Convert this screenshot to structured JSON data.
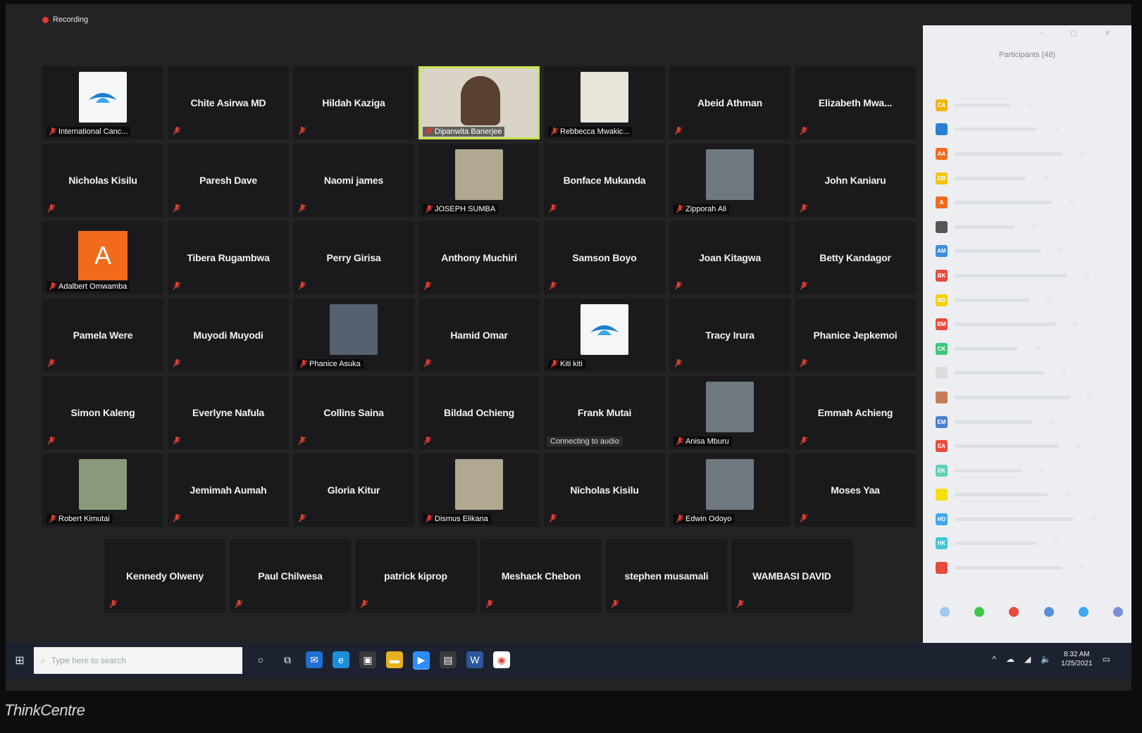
{
  "recording": {
    "label": "Recording"
  },
  "tiles": [
    {
      "name": "International Canc...",
      "type": "logo"
    },
    {
      "name": "Chite Asirwa MD",
      "type": "name"
    },
    {
      "name": "Hildah Kaziga",
      "type": "name"
    },
    {
      "name": "Dipanwita Banerjee",
      "type": "video",
      "active": true
    },
    {
      "name": "Rebbecca Mwakic...",
      "type": "photo"
    },
    {
      "name": "Abeid Athman",
      "type": "name"
    },
    {
      "name": "Elizabeth Mwa...",
      "type": "name"
    },
    {
      "name": "Nicholas Kisilu",
      "type": "name"
    },
    {
      "name": "Paresh Dave",
      "type": "name"
    },
    {
      "name": "Naomi james",
      "type": "name"
    },
    {
      "name": "JOSEPH SUMBA",
      "type": "photo"
    },
    {
      "name": "Bonface Mukanda",
      "type": "name"
    },
    {
      "name": "Zipporah Ali",
      "type": "photo"
    },
    {
      "name": "John Kaniaru",
      "type": "name"
    },
    {
      "name": "Adalbert Omwamba",
      "type": "letter",
      "letter": "A"
    },
    {
      "name": "Tibera Rugambwa",
      "type": "name"
    },
    {
      "name": "Perry Girisa",
      "type": "name"
    },
    {
      "name": "Anthony Muchiri",
      "type": "name"
    },
    {
      "name": "Samson Boyo",
      "type": "name"
    },
    {
      "name": "Joan Kitagwa",
      "type": "name"
    },
    {
      "name": "Betty Kandagor",
      "type": "name"
    },
    {
      "name": "Pamela Were",
      "type": "name"
    },
    {
      "name": "Muyodi Muyodi",
      "type": "name"
    },
    {
      "name": "Phanice Asuka",
      "type": "photo"
    },
    {
      "name": "Hamid Omar",
      "type": "name"
    },
    {
      "name": "Kiti kiti",
      "type": "logo"
    },
    {
      "name": "Tracy Irura",
      "type": "name"
    },
    {
      "name": "Phanice Jepkemoi",
      "type": "name"
    },
    {
      "name": "Simon Kaleng",
      "type": "name"
    },
    {
      "name": "Everlyne Nafula",
      "type": "name"
    },
    {
      "name": "Collins Saina",
      "type": "name"
    },
    {
      "name": "Bildad Ochieng",
      "type": "name"
    },
    {
      "name": "Frank Mutai",
      "type": "name",
      "status": "Connecting to audio"
    },
    {
      "name": "Anisa Mburu",
      "type": "photo"
    },
    {
      "name": "Emmah Achieng",
      "type": "name"
    },
    {
      "name": "Robert Kimutai",
      "type": "photo"
    },
    {
      "name": "Jemimah Aumah",
      "type": "name"
    },
    {
      "name": "Gloria Kitur",
      "type": "name"
    },
    {
      "name": "Dismus Elikana",
      "type": "photo"
    },
    {
      "name": "Nicholas Kisilu",
      "type": "name"
    },
    {
      "name": "Edwin Odoyo",
      "type": "photo"
    },
    {
      "name": "Moses Yaa",
      "type": "name"
    }
  ],
  "last_row": [
    {
      "name": "Kennedy Olweny"
    },
    {
      "name": "Paul Chilwesa"
    },
    {
      "name": "patrick kiprop"
    },
    {
      "name": "Meshack Chebon"
    },
    {
      "name": "stephen musamali"
    },
    {
      "name": "WAMBASI DAVID"
    }
  ],
  "participants_panel": {
    "title": "Participants (48)",
    "rows": [
      {
        "initials": "CA",
        "color": "#f5b400"
      },
      {
        "initials": "",
        "color": "#2a7fd4"
      },
      {
        "initials": "AA",
        "color": "#f26b1d"
      },
      {
        "initials": "DB",
        "color": "#f5c400"
      },
      {
        "initials": "A",
        "color": "#f26b1d"
      },
      {
        "initials": "",
        "color": "#555555"
      },
      {
        "initials": "AM",
        "color": "#3b8ee0"
      },
      {
        "initials": "BK",
        "color": "#e84a3c"
      },
      {
        "initials": "BD",
        "color": "#f5d000"
      },
      {
        "initials": "BM",
        "color": "#e84a3c"
      },
      {
        "initials": "CK",
        "color": "#3cc87a"
      },
      {
        "initials": "",
        "color": "#dddddd"
      },
      {
        "initials": "",
        "color": "#c77b56"
      },
      {
        "initials": "EM",
        "color": "#4a7fd4"
      },
      {
        "initials": "EA",
        "color": "#e84a3c"
      },
      {
        "initials": "EK",
        "color": "#5ed0b8"
      },
      {
        "initials": "",
        "color": "#f5e000"
      },
      {
        "initials": "HO",
        "color": "#3ba8f0"
      },
      {
        "initials": "HK",
        "color": "#3cc8d8"
      },
      {
        "initials": "",
        "color": "#e84a3c"
      }
    ],
    "footer_colors": [
      "#9ec9f0",
      "#3cc84a",
      "#e84a3c",
      "#5a8fd8",
      "#3ba8f0",
      "#7b8fd8"
    ]
  },
  "taskbar": {
    "search_placeholder": "Type here to search",
    "time": "8:32 AM",
    "date": "1/25/2021"
  },
  "brand": "ThinkCentre"
}
